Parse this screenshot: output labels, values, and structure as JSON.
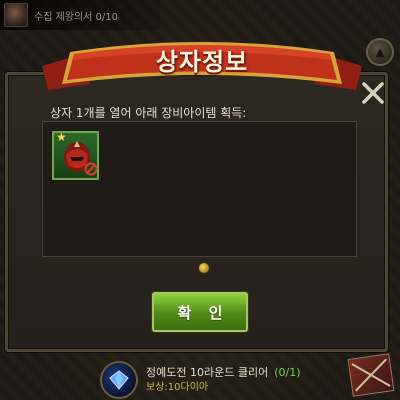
{
  "background": {
    "quest_top_text": "수집 제왕의서 0/10",
    "bottom_quest": {
      "title": "정예도전 10라운드 클리어",
      "progress": "(0/1)",
      "reward": "보상:10다이아"
    }
  },
  "dialog": {
    "title": "상자정보",
    "description": "상자 1개를 열어 아래 장비아이템 획득:",
    "items": [
      {
        "icon": "helmet-icon",
        "grade_star": "★",
        "frame_color": "#2d6a2a"
      }
    ],
    "confirm_label": "확 인"
  },
  "colors": {
    "ribbon": "#c0311c",
    "confirm": "#6fae28",
    "progress": "#6fd14f",
    "reward": "#d4b44a"
  }
}
